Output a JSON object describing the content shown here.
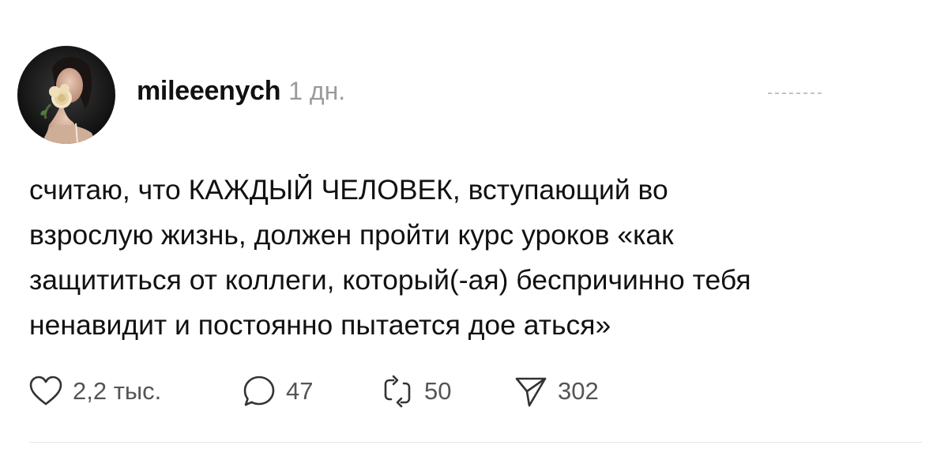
{
  "post": {
    "username": "mileeenych",
    "time_ago": "1 дн.",
    "text": "считаю, что КАЖДЫЙ ЧЕЛОВЕК, вступающий во\nвзрослую жизнь, должен пройти курс уроков «как\nзащититься от коллеги, который(-ая) беспричинно тебя\nненавидит и постоянно пытается дое  аться»",
    "avatar_icon": "profile-photo-avatar",
    "more_icon": "more-options-icon"
  },
  "actions": {
    "like": {
      "icon": "heart-icon",
      "count": "2,2 тыс."
    },
    "reply": {
      "icon": "comment-bubble-icon",
      "count": "47"
    },
    "repost": {
      "icon": "repost-icon",
      "count": "50"
    },
    "share": {
      "icon": "send-icon",
      "count": "302"
    }
  },
  "colors": {
    "text": "#111111",
    "muted": "#9a9a9a",
    "counts": "#555555",
    "divider": "#e6e6e6"
  }
}
